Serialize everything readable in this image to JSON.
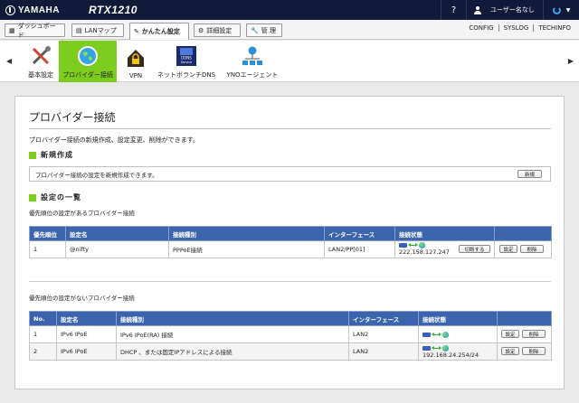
{
  "header": {
    "brand": "YAMAHA",
    "model": "RTX1210",
    "help_label": "?",
    "user_name": "ユーザー名なし"
  },
  "nav": {
    "tabs": [
      {
        "label": "ダッシュボード",
        "icon": "dashboard-icon"
      },
      {
        "label": "LANマップ",
        "icon": "lanmap-icon"
      },
      {
        "label": "かんたん設定",
        "icon": "easy-setup-icon"
      },
      {
        "label": "詳細設定",
        "icon": "gear-icon"
      },
      {
        "label": "管 理",
        "icon": "wrench-icon"
      }
    ],
    "links": [
      "CONFIG",
      "SYSLOG",
      "TECHINFO"
    ]
  },
  "ribbon": {
    "items": [
      {
        "label": "基本設定",
        "icon": "tools-icon"
      },
      {
        "label": "プロバイダー接続",
        "icon": "globe-icon"
      },
      {
        "label": "VPN",
        "icon": "lock-house-icon"
      },
      {
        "label": "ネットボランチDNS",
        "icon": "ddns-icon",
        "badge": "DDNS Service"
      },
      {
        "label": "YNOエージェント",
        "icon": "network-icon"
      }
    ]
  },
  "main": {
    "title": "プロバイダー接続",
    "description": "プロバイダー接続の新規作成、設定変更、削除ができます。",
    "new_section": {
      "heading": "新規作成",
      "text": "プロバイダー接続の設定を新規作成できます。",
      "button": "新規"
    },
    "list_section": {
      "heading": "設定の一覧",
      "priority_label": "優先順位の設定があるプロバイダー接続",
      "priority_table": {
        "headers": [
          "優先順位",
          "設定名",
          "接続種別",
          "インターフェース",
          "接続状態",
          ""
        ],
        "rows": [
          {
            "priority": "1",
            "name": "@nifty",
            "type": "PPPoE接続",
            "interface": "LAN2/PP[01]",
            "ip": "222.158.127.247",
            "disconnect": "切断する",
            "edit": "設定",
            "delete": "削除"
          }
        ]
      },
      "nopriority_label": "優先順位の設定がないプロバイダー接続",
      "nopriority_table": {
        "headers": [
          "No.",
          "設定名",
          "接続種別",
          "インターフェース",
          "接続状態",
          ""
        ],
        "rows": [
          {
            "no": "1",
            "name": "IPv6 IPoE",
            "type": "IPv6 IPoE(RA) 接続",
            "interface": "LAN2",
            "ip": "",
            "edit": "設定",
            "delete": "削除"
          },
          {
            "no": "2",
            "name": "IPv6 IPoE",
            "type": "DHCP 、または固定IPアドレスによる接続",
            "interface": "LAN2",
            "ip": "192.168.24.254/24",
            "edit": "設定",
            "delete": "削除"
          }
        ]
      }
    }
  },
  "colors": {
    "header_bg": "#121a3a",
    "accent_green": "#7ccd1e",
    "table_header": "#3c64ad"
  }
}
